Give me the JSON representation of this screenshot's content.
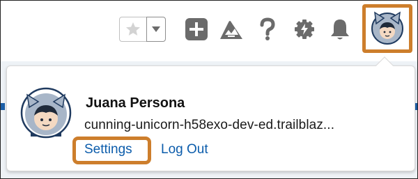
{
  "header": {
    "favorites_star_icon": "star-icon",
    "favorites_menu_icon": "caret-down-icon",
    "global_actions_icon": "add-icon",
    "trailhead_icon": "trailhead-icon",
    "help_icon": "question-icon",
    "setup_icon": "gear-icon",
    "notifications_icon": "bell-icon",
    "avatar_icon": "user-avatar-icon"
  },
  "profile_card": {
    "name": "Juana Persona",
    "org": "cunning-unicorn-h58exo-dev-ed.trailblaz...",
    "links": {
      "settings": "Settings",
      "logout": "Log Out"
    }
  },
  "colors": {
    "highlight": "#cd7e2c",
    "link": "#0b5cab",
    "icon": "#6b6b6b",
    "avatar_bg": "#a8b6c8"
  }
}
